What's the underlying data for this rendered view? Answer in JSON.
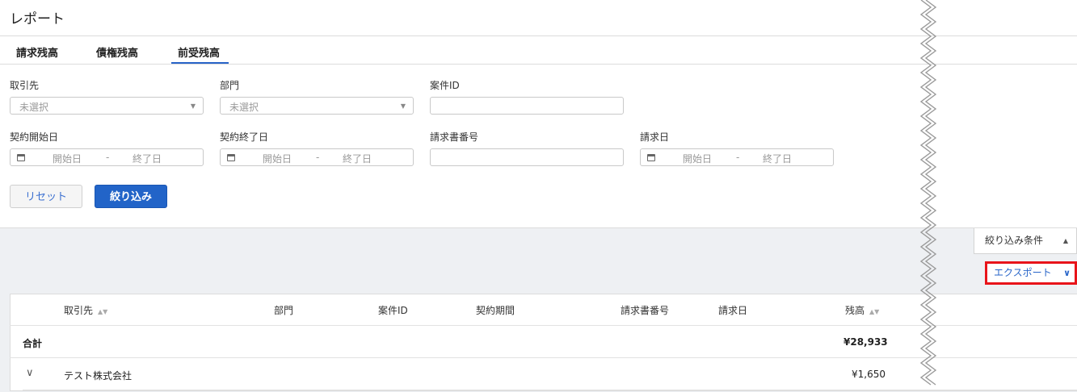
{
  "page": {
    "title": "レポート"
  },
  "tabs": [
    {
      "label": "請求残高",
      "active": false
    },
    {
      "label": "債権残高",
      "active": false
    },
    {
      "label": "前受残高",
      "active": true
    }
  ],
  "filters": {
    "client": {
      "label": "取引先",
      "placeholder": "未選択"
    },
    "department": {
      "label": "部門",
      "placeholder": "未選択"
    },
    "case_id": {
      "label": "案件ID",
      "value": ""
    },
    "contract_start": {
      "label": "契約開始日",
      "start_placeholder": "開始日",
      "separator": "-",
      "end_placeholder": "終了日"
    },
    "contract_end": {
      "label": "契約終了日",
      "start_placeholder": "開始日",
      "separator": "-",
      "end_placeholder": "終了日"
    },
    "invoice_number": {
      "label": "請求書番号",
      "value": ""
    },
    "invoice_date": {
      "label": "請求日",
      "start_placeholder": "開始日",
      "separator": "-",
      "end_placeholder": "終了日"
    }
  },
  "buttons": {
    "reset": "リセット",
    "apply": "絞り込み"
  },
  "filter_toggle": {
    "label": "絞り込み条件",
    "icon": "triangle-up-icon"
  },
  "export": {
    "label": "エクスポート",
    "icon": "chevron-down-icon",
    "highlight_color": "#e8141a"
  },
  "table": {
    "columns": [
      "取引先",
      "部門",
      "案件ID",
      "契約期間",
      "請求書番号",
      "請求日",
      "残高"
    ],
    "total_row": {
      "label": "合計",
      "balance": "¥28,933"
    },
    "rows": [
      {
        "client": "テスト株式会社",
        "balance": "¥1,650",
        "expand_icon": "chevron-down-icon"
      }
    ]
  },
  "colors": {
    "accent": "#2264c8",
    "link": "#2a66c9",
    "highlight": "#e8141a",
    "panel_bg": "#eef0f3"
  }
}
